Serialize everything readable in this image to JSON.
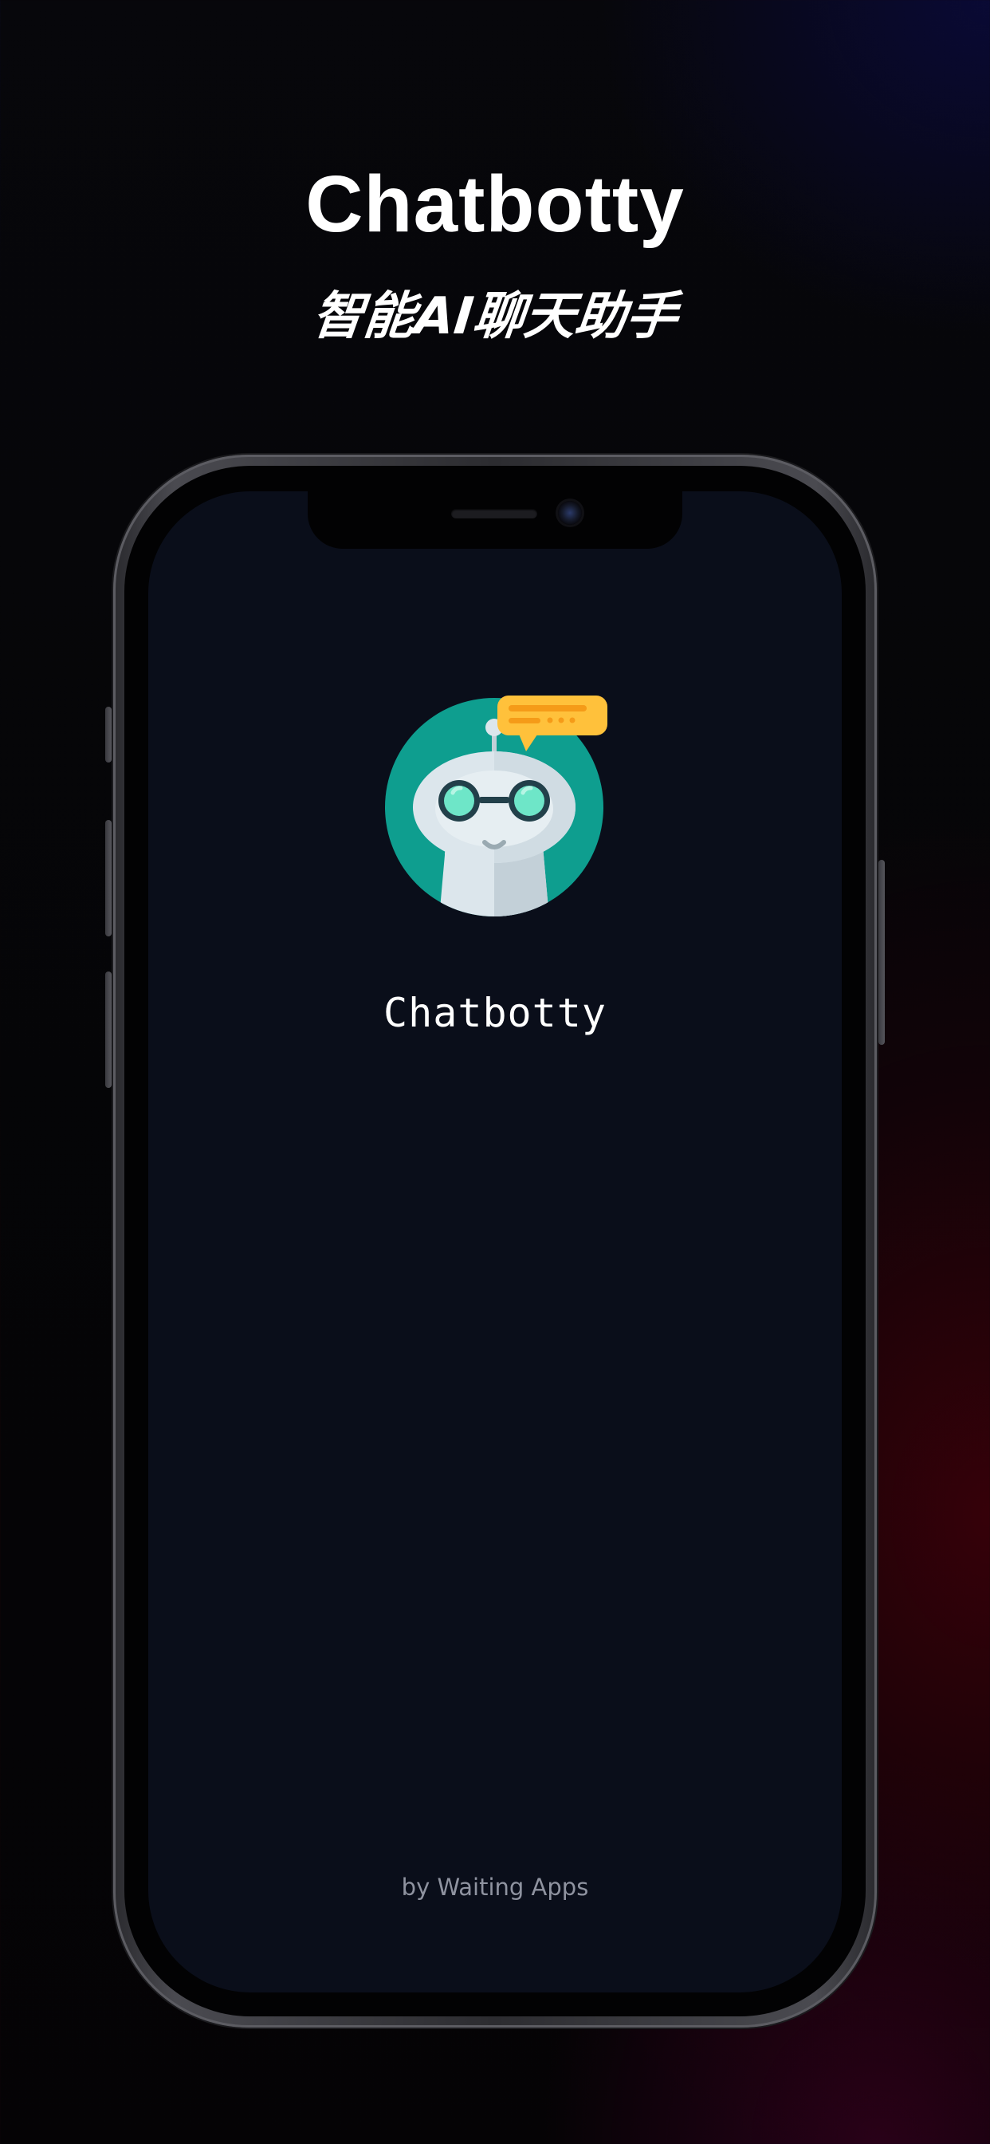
{
  "marketing": {
    "headline": "Chatbotty",
    "subheadline": "智能AI聊天助手"
  },
  "splash": {
    "logo_icon": "robot-chat-icon",
    "app_name": "Chatbotty",
    "credit": "by Waiting Apps"
  },
  "colors": {
    "screen_background": "#0a0e1a",
    "logo_circle": "#0e9e8f",
    "speech_bubble": "#ffc13b",
    "robot_body": "#dce6ec",
    "robot_eyes": "#6ee6c8"
  }
}
